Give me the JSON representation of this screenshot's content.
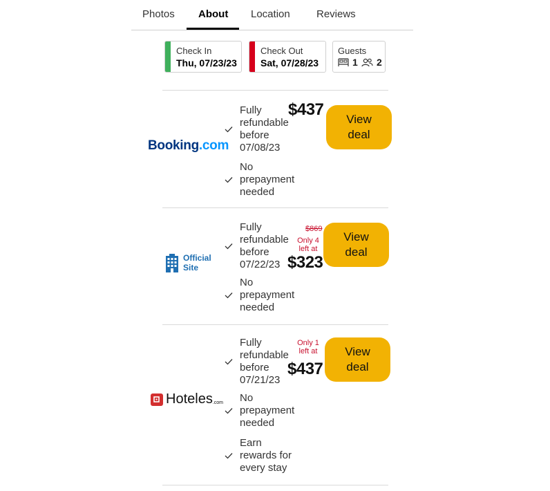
{
  "tabs": [
    "Photos",
    "About",
    "Location",
    "Reviews"
  ],
  "active_tab": "About",
  "search": {
    "check_in": {
      "label": "Check In",
      "value": "Thu, 07/23/23",
      "color": "#3fb05c"
    },
    "check_out": {
      "label": "Check Out",
      "value": "Sat, 07/28/23",
      "color": "#d6001c"
    },
    "guests": {
      "label": "Guests",
      "rooms": "1",
      "adults": "2"
    }
  },
  "offers": [
    {
      "provider": {
        "brand_a": "Booking",
        "brand_b": ".com"
      },
      "features": [
        {
          "l1": "Fully",
          "l2": "refundable",
          "l3": "before",
          "l4": "07/08/23"
        },
        {
          "l1": "No",
          "l2": "prepayment",
          "l3": "needed"
        }
      ],
      "price": "$437",
      "button": {
        "l1": "View",
        "l2": "deal"
      }
    },
    {
      "provider": {
        "line1": "Official",
        "line2": "Site"
      },
      "features": [
        {
          "l1": "Fully",
          "l2": "refundable",
          "l3": "before",
          "l4": "07/22/23"
        },
        {
          "l1": "No",
          "l2": "prepayment",
          "l3": "needed"
        }
      ],
      "old_price": "$869",
      "availability": {
        "l1": "Only 4",
        "l2": "left at"
      },
      "price": "$323",
      "button": {
        "l1": "View",
        "l2": "deal"
      }
    },
    {
      "provider": {
        "name": "Hoteles",
        "suffix": ".com"
      },
      "features": [
        {
          "l1": "Fully",
          "l2": "refundable",
          "l3": "before",
          "l4": "07/21/23"
        },
        {
          "l1": "No",
          "l2": "prepayment",
          "l3": "needed"
        },
        {
          "l1": "Earn",
          "l2": "rewards for",
          "l3": "every stay"
        }
      ],
      "availability": {
        "l1": "Only 1",
        "l2": "left at"
      },
      "price": "$437",
      "button": {
        "l1": "View",
        "l2": "deal"
      }
    }
  ],
  "colors": {
    "deal_button": "#f2b203",
    "alert": "#c8102e",
    "booking_blue": "#003580",
    "booking_light": "#0896ff",
    "hoteles_red": "#d32f2f"
  },
  "icons": [
    "check-icon",
    "bed-icon",
    "people-icon",
    "building-icon"
  ]
}
